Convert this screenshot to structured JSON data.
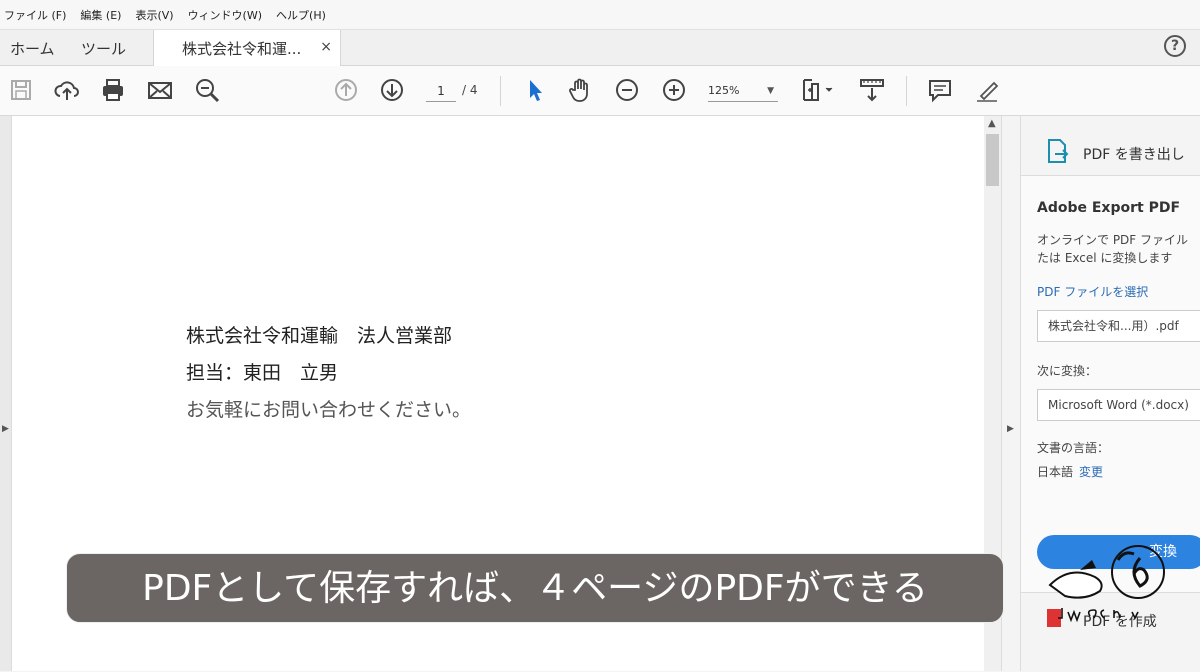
{
  "menubar": {
    "items": [
      "ファイル (F)",
      "編集 (E)",
      "表示(V)",
      "ウィンドウ(W)",
      "ヘルプ(H)"
    ]
  },
  "tabs": {
    "home": "ホーム",
    "tools": "ツール",
    "document": "株式会社令和運...",
    "close": "×",
    "help": "?"
  },
  "toolbar": {
    "page_current": "1",
    "page_total": "/ 4",
    "zoom": "125%",
    "icons": [
      "save-icon",
      "cloud-upload-icon",
      "print-icon",
      "mail-icon",
      "search-zoom-icon",
      "prev-page-icon",
      "next-page-icon",
      "select-cursor-icon",
      "hand-icon",
      "zoom-out-icon",
      "zoom-in-icon",
      "fit-page-icon",
      "scroll-mode-icon",
      "comment-icon",
      "sign-icon"
    ]
  },
  "document": {
    "lines": [
      "株式会社令和運輸　法人営業部",
      "担当：東田　立男",
      "お気軽にお問い合わせください。"
    ]
  },
  "right_panel": {
    "header": "PDF を書き出し",
    "title": "Adobe Export PDF",
    "desc_line1": "オンラインで PDF ファイル",
    "desc_line2": "たは Excel に変換します",
    "select_link": "PDF ファイルを選択",
    "file_name": "株式会社令和...用）.pdf",
    "convert_to_label": "次に変換：",
    "convert_to_value": "Microsoft Word (*.docx)",
    "lang_label": "文書の言語：",
    "lang_value": "日本語",
    "lang_change": "変更",
    "convert_button": "変換",
    "create_pdf": "PDF を作成"
  },
  "caption": {
    "text": "PDFとして保存すれば、４ページのPDFができる"
  },
  "colors": {
    "accent": "#2d83e0",
    "link": "#2b6bb5",
    "caption_bg": "#6b6663"
  }
}
